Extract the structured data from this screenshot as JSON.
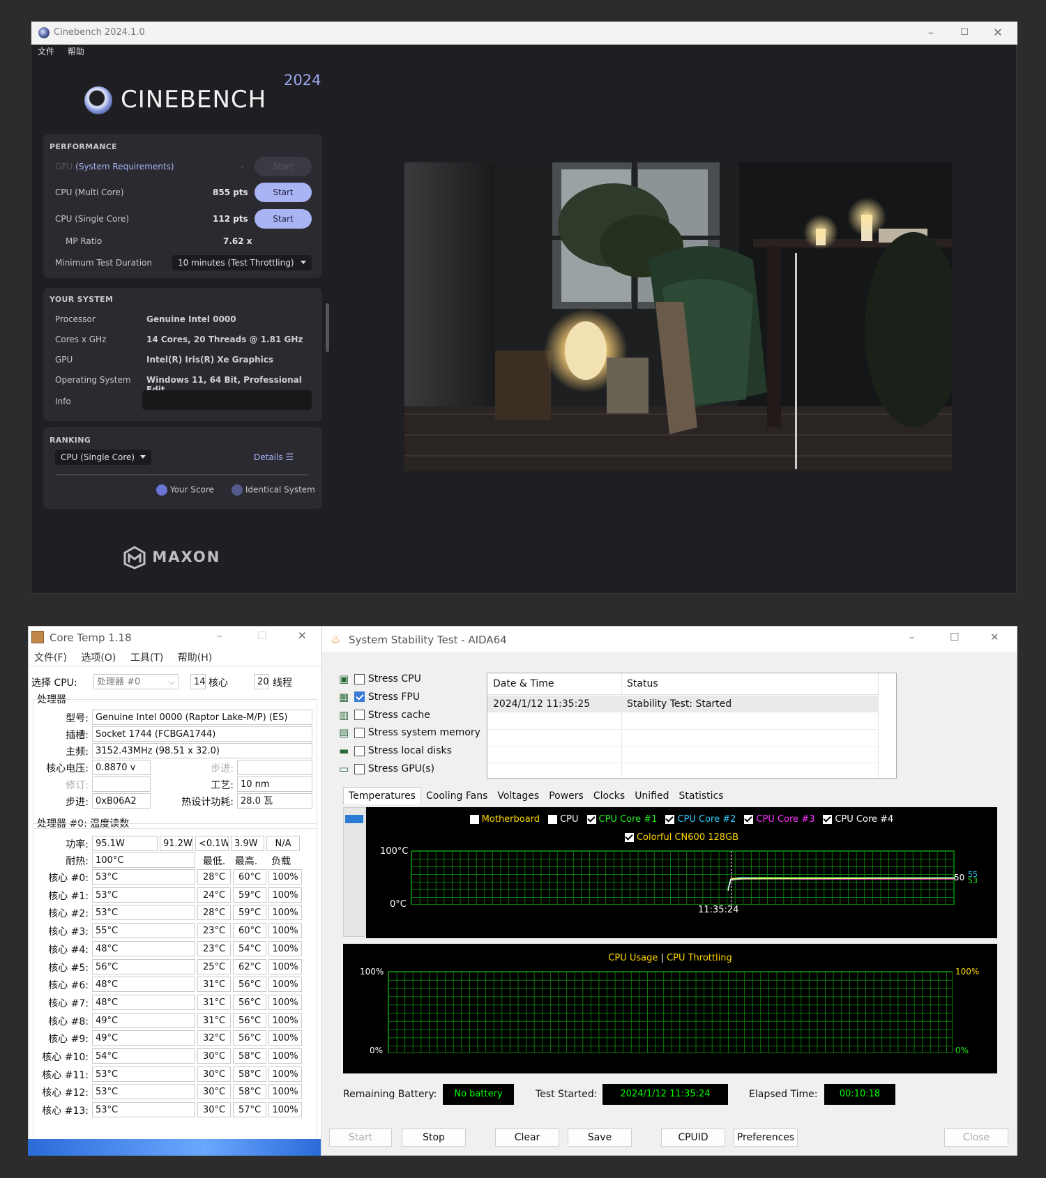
{
  "cinebench": {
    "window_title": "Cinebench 2024.1.0",
    "menu": [
      "文件",
      "帮助"
    ],
    "logo": "CINEBENCH",
    "year": "2024",
    "performance": {
      "header": "PERFORMANCE",
      "gpu_label": "GPU",
      "gpu_req": "(System Requirements)",
      "gpu_value": "-",
      "gpu_button": "Start",
      "cpu_multi_label": "CPU (Multi Core)",
      "cpu_multi_value": "855 pts",
      "cpu_multi_button": "Start",
      "cpu_single_label": "CPU (Single Core)",
      "cpu_single_value": "112 pts",
      "cpu_single_button": "Start",
      "mp_ratio_label": "MP Ratio",
      "mp_ratio_value": "7.62 x",
      "min_duration_label": "Minimum Test Duration",
      "min_duration_value": "10 minutes (Test Throttling)"
    },
    "your_system": {
      "header": "YOUR SYSTEM",
      "rows": [
        {
          "label": "Processor",
          "value": "Genuine Intel 0000"
        },
        {
          "label": "Cores x GHz",
          "value": "14 Cores, 20 Threads @ 1.81 GHz"
        },
        {
          "label": "GPU",
          "value": "Intel(R) Iris(R) Xe Graphics"
        },
        {
          "label": "Operating System",
          "value": "Windows 11, 64 Bit, Professional Edit..."
        },
        {
          "label": "Info",
          "value": ""
        }
      ]
    },
    "ranking": {
      "header": "RANKING",
      "select": "CPU (Single Core)",
      "details": "Details",
      "legend_your": "Your Score",
      "legend_identical": "Identical System"
    },
    "brand": "MAXON",
    "colors": {
      "accent": "#a9b4f5",
      "bg": "#1f1f23",
      "panel": "#2a2a30"
    }
  },
  "coretemp": {
    "window_title": "Core Temp 1.18",
    "menu": [
      "文件(F)",
      "选项(O)",
      "工具(T)",
      "帮助(H)"
    ],
    "select_cpu_label": "选择 CPU:",
    "select_cpu_value": "处理器 #0",
    "cores_num": "14",
    "cores_label": "核心",
    "threads_num": "20",
    "threads_label": "线程",
    "processor_group": "处理器",
    "model_label": "型号:",
    "model_value": "Genuine Intel 0000 (Raptor Lake-M/P)  (ES)",
    "socket_label": "插槽:",
    "socket_value": "Socket 1744 (FCBGA1744)",
    "freq_label": "主频:",
    "freq_value": "3152.43MHz (98.51 x 32.0)",
    "vid_label": "核心电压:",
    "vid_value": "0.8870 v",
    "stepping_label_r": "步进:",
    "stepping_value_r": "",
    "revision_label": "修订:",
    "revision_value": "",
    "lithography_label": "工艺:",
    "lithography_value": "10 nm",
    "stepping_label": "步进:",
    "stepping_value": "0xB06A2",
    "tdp_label": "热设计功耗:",
    "tdp_value": "28.0 瓦",
    "temp_group": "处理器 #0: 温度读数",
    "power_label": "功率:",
    "power_values": [
      "95.1W",
      "91.2W",
      "<0.1W",
      "3.9W",
      "N/A"
    ],
    "tjmax_label": "耐热:",
    "tjmax_value": "100°C",
    "col_min": "最低.",
    "col_max": "最高.",
    "col_load": "负载",
    "cores": [
      {
        "label": "核心 #0:",
        "temp": "53°C",
        "min": "28°C",
        "max": "60°C",
        "load": "100%"
      },
      {
        "label": "核心 #1:",
        "temp": "53°C",
        "min": "24°C",
        "max": "59°C",
        "load": "100%"
      },
      {
        "label": "核心 #2:",
        "temp": "53°C",
        "min": "28°C",
        "max": "59°C",
        "load": "100%"
      },
      {
        "label": "核心 #3:",
        "temp": "55°C",
        "min": "23°C",
        "max": "60°C",
        "load": "100%"
      },
      {
        "label": "核心 #4:",
        "temp": "48°C",
        "min": "23°C",
        "max": "54°C",
        "load": "100%"
      },
      {
        "label": "核心 #5:",
        "temp": "56°C",
        "min": "25°C",
        "max": "62°C",
        "load": "100%"
      },
      {
        "label": "核心 #6:",
        "temp": "48°C",
        "min": "31°C",
        "max": "56°C",
        "load": "100%"
      },
      {
        "label": "核心 #7:",
        "temp": "48°C",
        "min": "31°C",
        "max": "56°C",
        "load": "100%"
      },
      {
        "label": "核心 #8:",
        "temp": "49°C",
        "min": "31°C",
        "max": "56°C",
        "load": "100%"
      },
      {
        "label": "核心 #9:",
        "temp": "49°C",
        "min": "32°C",
        "max": "56°C",
        "load": "100%"
      },
      {
        "label": "核心 #10:",
        "temp": "54°C",
        "min": "30°C",
        "max": "58°C",
        "load": "100%"
      },
      {
        "label": "核心 #11:",
        "temp": "53°C",
        "min": "30°C",
        "max": "58°C",
        "load": "100%"
      },
      {
        "label": "核心 #12:",
        "temp": "53°C",
        "min": "30°C",
        "max": "58°C",
        "load": "100%"
      },
      {
        "label": "核心 #13:",
        "temp": "53°C",
        "min": "30°C",
        "max": "57°C",
        "load": "100%"
      }
    ]
  },
  "aida": {
    "window_title": "System Stability Test - AIDA64",
    "stress": [
      {
        "label": "Stress CPU",
        "checked": false,
        "icon": "cpu-chip-icon"
      },
      {
        "label": "Stress FPU",
        "checked": true,
        "icon": "fpu-icon"
      },
      {
        "label": "Stress cache",
        "checked": false,
        "icon": "cache-icon"
      },
      {
        "label": "Stress system memory",
        "checked": false,
        "icon": "memory-icon"
      },
      {
        "label": "Stress local disks",
        "checked": false,
        "icon": "disk-icon"
      },
      {
        "label": "Stress GPU(s)",
        "checked": false,
        "icon": "monitor-icon"
      }
    ],
    "log_headers": [
      "Date & Time",
      "Status"
    ],
    "log_rows": [
      [
        "2024/1/12 11:35:25",
        "Stability Test: Started"
      ]
    ],
    "tabs": [
      "Temperatures",
      "Cooling Fans",
      "Voltages",
      "Powers",
      "Clocks",
      "Unified",
      "Statistics"
    ],
    "legend": [
      {
        "label": "Motherboard",
        "checked": false,
        "color": "#ffd700"
      },
      {
        "label": "CPU",
        "checked": false,
        "color": "#ffffff"
      },
      {
        "label": "CPU Core #1",
        "checked": true,
        "color": "#22ee22"
      },
      {
        "label": "CPU Core #2",
        "checked": true,
        "color": "#33ccff"
      },
      {
        "label": "CPU Core #3",
        "checked": true,
        "color": "#ff33ff"
      },
      {
        "label": "CPU Core #4",
        "checked": true,
        "color": "#ffffff"
      },
      {
        "label": "Colorful CN600 128GB",
        "checked": true,
        "color": "#ffd700"
      }
    ],
    "temp_ymax": "100°C",
    "temp_ymin": "0°C",
    "temp_time": "11:35:24",
    "temp_readout_1": "50",
    "temp_readout_2": "55",
    "temp_readout_3": "53",
    "usage_title_1": "CPU Usage",
    "usage_sep": "|",
    "usage_title_2": "CPU Throttling",
    "usage_left_top": "100%",
    "usage_left_bottom": "0%",
    "usage_right_top": "100%",
    "usage_right_bottom": "0%",
    "battery_label": "Remaining Battery:",
    "battery_value": "No battery",
    "started_label": "Test Started:",
    "started_value": "2024/1/12 11:35:24",
    "elapsed_label": "Elapsed Time:",
    "elapsed_value": "00:10:18",
    "buttons": {
      "start": "Start",
      "stop": "Stop",
      "clear": "Clear",
      "save": "Save",
      "cpuid": "CPUID",
      "prefs": "Preferences",
      "close": "Close"
    }
  }
}
